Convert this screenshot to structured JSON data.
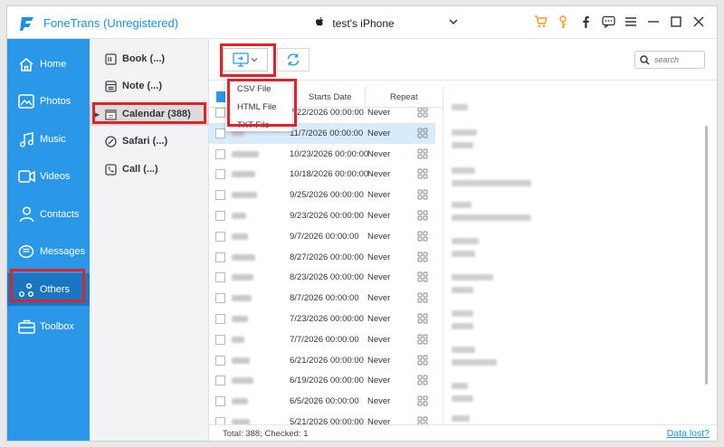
{
  "app": {
    "title": "FoneTrans (Unregistered)",
    "device": "test's iPhone",
    "accent": "#2b97e8"
  },
  "titlebar_icons": [
    "cart-icon",
    "key-icon",
    "facebook-icon",
    "chat-icon",
    "menu-icon",
    "minimize-icon",
    "maximize-icon",
    "close-icon"
  ],
  "sidebar": {
    "items": [
      {
        "label": "Home",
        "icon": "home-icon"
      },
      {
        "label": "Photos",
        "icon": "photos-icon"
      },
      {
        "label": "Music",
        "icon": "music-icon"
      },
      {
        "label": "Videos",
        "icon": "videos-icon"
      },
      {
        "label": "Contacts",
        "icon": "contacts-icon"
      },
      {
        "label": "Messages",
        "icon": "messages-icon"
      },
      {
        "label": "Others",
        "icon": "others-icon"
      },
      {
        "label": "Toolbox",
        "icon": "toolbox-icon"
      }
    ],
    "active": "Others"
  },
  "categories": {
    "items": [
      {
        "label": "Book (...)",
        "icon": "book-icon"
      },
      {
        "label": "Note (...)",
        "icon": "note-icon"
      },
      {
        "label": "Calendar (388)",
        "icon": "calendar-icon"
      },
      {
        "label": "Safari (...)",
        "icon": "safari-icon"
      },
      {
        "label": "Call (...)",
        "icon": "call-icon"
      }
    ],
    "active": "Calendar (388)"
  },
  "toolbar": {
    "search_placeholder": "search"
  },
  "export_menu": {
    "options": [
      "CSV File",
      "HTML File",
      "TXT File"
    ]
  },
  "table": {
    "headers": {
      "starts": "Starts Date",
      "repeat": "Repeat"
    },
    "rows": [
      {
        "date": "7/22/2026 00:00:00",
        "repeat": "Never",
        "selected": false
      },
      {
        "date": "11/7/2026 00:00:00",
        "repeat": "Never",
        "selected": true
      },
      {
        "date": "10/23/2026 00:00:00",
        "repeat": "Never",
        "selected": false
      },
      {
        "date": "10/18/2026 00:00:00",
        "repeat": "Never",
        "selected": false
      },
      {
        "date": "9/25/2026 00:00:00",
        "repeat": "Never",
        "selected": false
      },
      {
        "date": "9/23/2026 00:00:00",
        "repeat": "Never",
        "selected": false
      },
      {
        "date": "9/7/2026 00:00:00",
        "repeat": "Never",
        "selected": false
      },
      {
        "date": "8/27/2026 00:00:00",
        "repeat": "Never",
        "selected": false
      },
      {
        "date": "8/23/2026 00:00:00",
        "repeat": "Never",
        "selected": false
      },
      {
        "date": "8/7/2026 00:00:00",
        "repeat": "Never",
        "selected": false
      },
      {
        "date": "7/23/2026 00:00:00",
        "repeat": "Never",
        "selected": false
      },
      {
        "date": "7/7/2026 00:00:00",
        "repeat": "Never",
        "selected": false
      },
      {
        "date": "6/21/2026 00:00:00",
        "repeat": "Never",
        "selected": false
      },
      {
        "date": "6/19/2026 00:00:00",
        "repeat": "Never",
        "selected": false
      },
      {
        "date": "6/5/2026 00:00:00",
        "repeat": "Never",
        "selected": false
      },
      {
        "date": "5/21/2026 00:00:00",
        "repeat": "Never",
        "selected": false
      }
    ]
  },
  "footer": {
    "total": "Total: 388; Checked: 1",
    "data_lost": "Data lost?"
  }
}
